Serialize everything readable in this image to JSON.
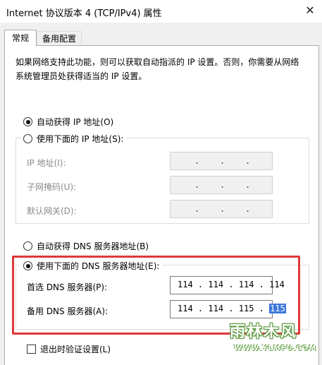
{
  "window": {
    "title": "Internet 协议版本 4 (TCP/IPv4) 属性",
    "close_glyph": "✕"
  },
  "tabs": [
    {
      "label": "常规",
      "active": true
    },
    {
      "label": "备用配置",
      "active": false
    }
  ],
  "description": "如果网络支持此功能，则可以获取自动指派的 IP 设置。否则，你需要从网络系统管理员处获得适当的 IP 设置。",
  "ip_mode": {
    "auto_label": "自动获得 IP 地址(O)",
    "manual_label": "使用下面的 IP 地址(S):",
    "selected": "auto"
  },
  "ip_fields": [
    {
      "label": "IP 地址(I):",
      "value": "",
      "enabled": false
    },
    {
      "label": "子网掩码(U):",
      "value": "",
      "enabled": false
    },
    {
      "label": "默认网关(D):",
      "value": "",
      "enabled": false
    }
  ],
  "dns_mode": {
    "auto_label": "自动获得 DNS 服务器地址(B)",
    "manual_label": "使用下面的 DNS 服务器地址(E):",
    "selected": "manual"
  },
  "dns_fields": [
    {
      "label": "首选 DNS 服务器(P):",
      "octets": [
        "114",
        "114",
        "114",
        "114"
      ]
    },
    {
      "label": "备用 DNS 服务器(A):",
      "octets": [
        "114",
        "114",
        "115",
        "115"
      ],
      "selected_octet": 3
    }
  ],
  "validate_on_exit": {
    "label": "退出时验证设置(L)",
    "checked": false
  },
  "watermark": {
    "logo": "雨林木风",
    "url": "WWW.YLMFU.COM"
  },
  "colors": {
    "highlight_box": "#e03838",
    "selection": "#3c78d8"
  }
}
